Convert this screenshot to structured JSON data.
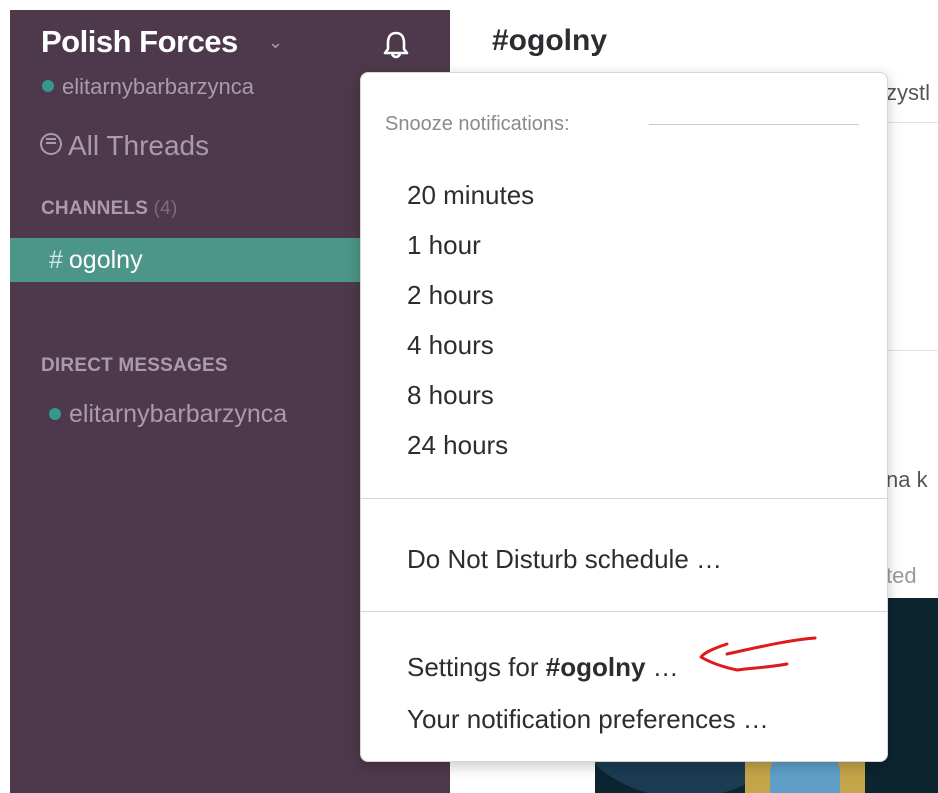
{
  "sidebar": {
    "team_name": "Polish Forces",
    "user_name": "elitarnybarbarzynca",
    "all_threads": "All Threads",
    "channels_title": "CHANNELS",
    "channels_count": "(4)",
    "active_channel": "ogolny",
    "hash": "#",
    "dm_title": "DIRECT MESSAGES",
    "dm_user": "elitarnybarbarzynca"
  },
  "main": {
    "channel_title": "#ogolny",
    "fragments": [
      "zystl",
      "na k",
      "ted"
    ]
  },
  "menu": {
    "header": "Snooze notifications:",
    "snooze_options": [
      "20 minutes",
      "1 hour",
      "2 hours",
      "4 hours",
      "8 hours",
      "24 hours"
    ],
    "dnd_schedule": "Do Not Disturb schedule …",
    "settings_prefix": "Settings for",
    "settings_channel": "#ogolny",
    "settings_suffix": "…",
    "preferences": "Your notification preferences …"
  },
  "colors": {
    "sidebar_bg": "#4d394b",
    "active_channel_bg": "#4c9689",
    "presence_dot": "#38978d",
    "annotation_arrow": "#e0191b"
  }
}
